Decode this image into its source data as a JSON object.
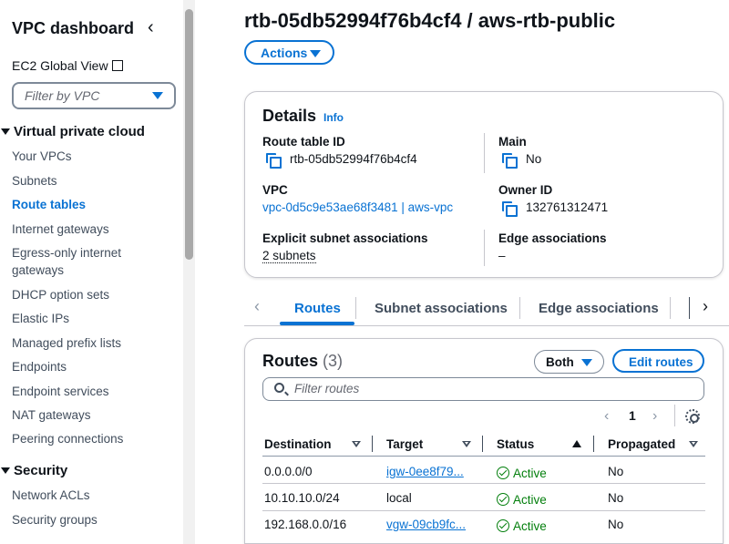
{
  "sidebar": {
    "title": "VPC dashboard",
    "ec2_global_view": "EC2 Global View",
    "filter_placeholder": "Filter by VPC",
    "sections": [
      {
        "label": "Virtual private cloud",
        "items": [
          "Your VPCs",
          "Subnets",
          "Route tables",
          "Internet gateways",
          "Egress-only internet gateways",
          "DHCP option sets",
          "Elastic IPs",
          "Managed prefix lists",
          "Endpoints",
          "Endpoint services",
          "NAT gateways",
          "Peering connections"
        ]
      },
      {
        "label": "Security",
        "items": [
          "Network ACLs",
          "Security groups"
        ]
      }
    ],
    "active_item": "Route tables"
  },
  "page": {
    "title": "rtb-05db52994f76b4cf4 / aws-rtb-public",
    "actions_label": "Actions"
  },
  "details": {
    "title": "Details",
    "info": "Info",
    "route_table_id_label": "Route table ID",
    "route_table_id": "rtb-05db52994f76b4cf4",
    "main_label": "Main",
    "main_value": "No",
    "vpc_label": "VPC",
    "vpc_value": "vpc-0d5c9e53ae68f3481 | aws-vpc",
    "owner_id_label": "Owner ID",
    "owner_id": "132761312471",
    "explicit_subnet_label": "Explicit subnet associations",
    "explicit_subnet_value": "2 subnets",
    "edge_assoc_label": "Edge associations",
    "edge_assoc_value": "–"
  },
  "tabs": [
    {
      "label": "Routes",
      "active": true
    },
    {
      "label": "Subnet associations",
      "active": false
    },
    {
      "label": "Edge associations",
      "active": false
    }
  ],
  "routes": {
    "title": "Routes",
    "count": "(3)",
    "filter_value": "Both",
    "edit_label": "Edit routes",
    "search_placeholder": "Filter routes",
    "page": "1",
    "columns": [
      "Destination",
      "Target",
      "Status",
      "Propagated"
    ],
    "rows": [
      {
        "destination": "0.0.0.0/0",
        "target": "igw-0ee8f79...",
        "target_is_link": true,
        "status": "Active",
        "propagated": "No"
      },
      {
        "destination": "10.10.10.0/24",
        "target": "local",
        "target_is_link": false,
        "status": "Active",
        "propagated": "No"
      },
      {
        "destination": "192.168.0.0/16",
        "target": "vgw-09cb9fc...",
        "target_is_link": true,
        "status": "Active",
        "propagated": "No"
      }
    ]
  },
  "colors": {
    "accent": "#0972d3",
    "success": "#037f0c",
    "text": "#0f141a",
    "border": "#c6c6cd"
  },
  "icons": [
    "chevron-left-icon",
    "external-link-icon",
    "caret-down-icon",
    "copy-icon",
    "search-icon",
    "gear-icon",
    "status-success-icon",
    "sort-icon"
  ]
}
